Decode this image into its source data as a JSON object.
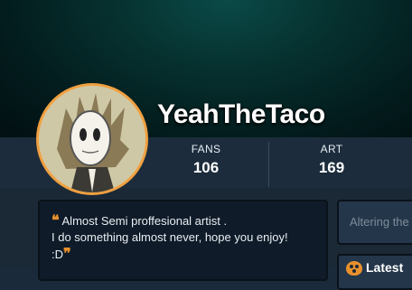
{
  "profile": {
    "username": "YeahTheTaco",
    "avatar_icon": "cartoon-character-avatar",
    "accent_color": "#f0a040"
  },
  "stats": {
    "fans_label": "FANS",
    "fans_value": "106",
    "art_label": "ART",
    "art_value": "169"
  },
  "bio": {
    "line1": "Almost Semi proffesional artist .",
    "line2": "I do something almost never, hope you enjoy!",
    "line3": ":D",
    "open_quote": "❝",
    "close_quote": "❞"
  },
  "side_panel": {
    "status_placeholder": "Altering the",
    "section_title": "Latest",
    "section_icon": "palette-icon"
  }
}
